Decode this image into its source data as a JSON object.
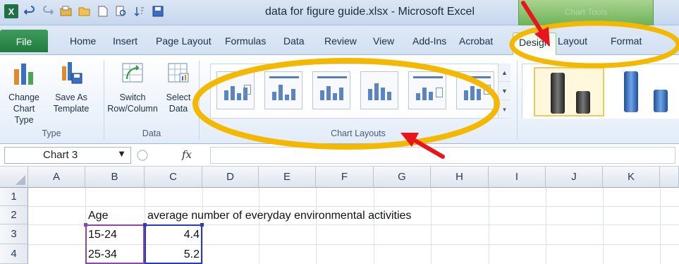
{
  "title_bar": {
    "window_title": "data for figure guide.xlsx - Microsoft Excel",
    "app_icon_letter": "X",
    "qat_icons": [
      "undo-icon",
      "redo-icon",
      "open-icon",
      "folder-icon",
      "new-icon",
      "print-preview-icon",
      "sort-icon",
      "save-icon"
    ],
    "context_tab_group_label": "Chart Tools"
  },
  "ribbon_tabs": [
    {
      "id": "file",
      "label": "File"
    },
    {
      "id": "home",
      "label": "Home"
    },
    {
      "id": "insert",
      "label": "Insert"
    },
    {
      "id": "page_layout",
      "label": "Page Layout"
    },
    {
      "id": "formulas",
      "label": "Formulas"
    },
    {
      "id": "data",
      "label": "Data"
    },
    {
      "id": "review",
      "label": "Review"
    },
    {
      "id": "view",
      "label": "View"
    },
    {
      "id": "addins",
      "label": "Add-Ins"
    },
    {
      "id": "acrobat",
      "label": "Acrobat"
    },
    {
      "id": "design",
      "label": "Design",
      "active": true
    },
    {
      "id": "layout",
      "label": "Layout"
    },
    {
      "id": "format",
      "label": "Format"
    }
  ],
  "ribbon": {
    "type_group": {
      "label": "Type",
      "change_chart_type": [
        "Change",
        "Chart Type"
      ],
      "save_as_template": [
        "Save As",
        "Template"
      ]
    },
    "data_group": {
      "label": "Data",
      "switch_row_column": [
        "Switch",
        "Row/Column"
      ],
      "select_data": [
        "Select",
        "Data"
      ]
    },
    "chart_layouts_group": {
      "label": "Chart Layouts",
      "layout_count_visible": 6
    },
    "chart_styles": {
      "selected_index": 0
    }
  },
  "formula_bar": {
    "name_box": "Chart 3",
    "fx_label": "fx",
    "formula": ""
  },
  "sheet": {
    "columns": [
      "A",
      "B",
      "C",
      "D",
      "E",
      "F",
      "G",
      "H",
      "I",
      "J",
      "K"
    ],
    "rows": [
      "1",
      "2",
      "3",
      "4"
    ],
    "cells": {
      "B2": "Age",
      "C2": "average number of everyday environmental activities",
      "B3": "15-24",
      "C3": "4.4",
      "B4": "25-34",
      "C4": "5.2"
    }
  },
  "annotations": {
    "highlight_color": "#f5b800",
    "arrow_color": "#e8151b",
    "ribbon_active_color": "#1f7a3d"
  }
}
